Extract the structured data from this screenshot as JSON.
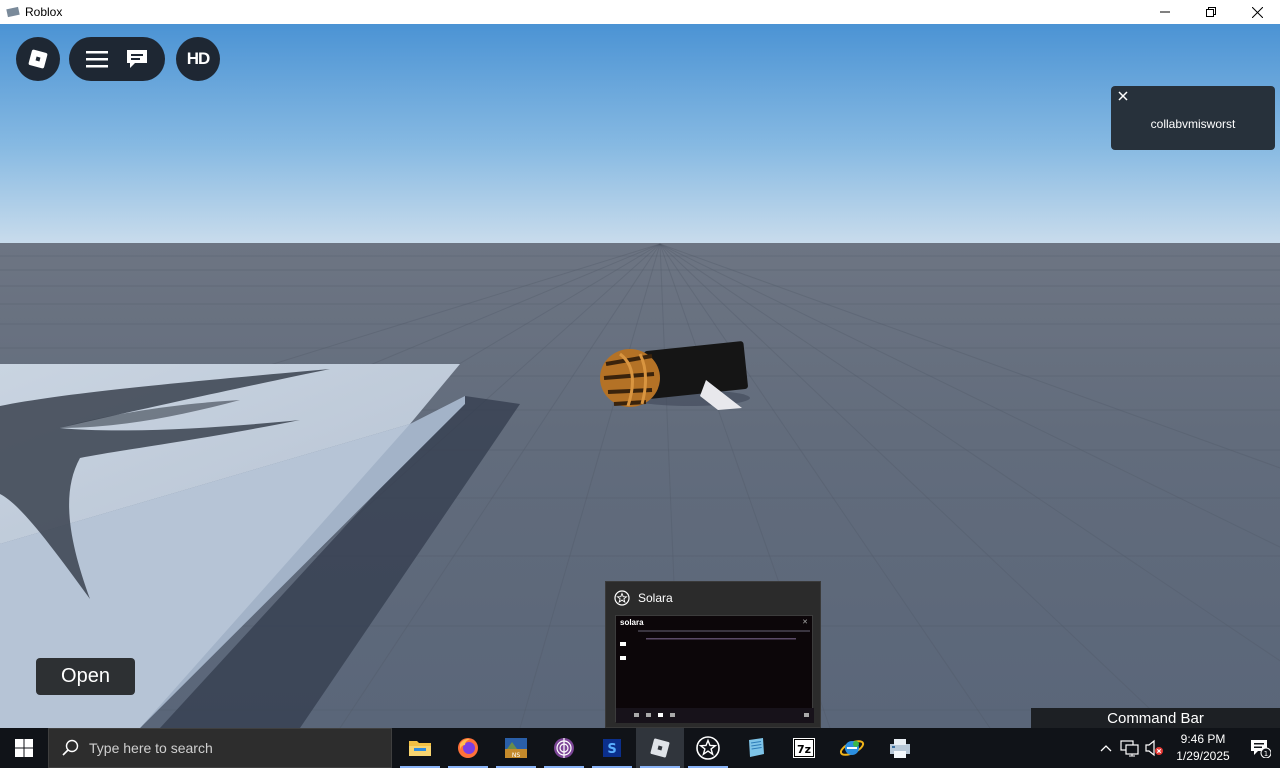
{
  "window": {
    "title": "Roblox",
    "icon": "roblox-app-icon"
  },
  "top_buttons": {
    "logo_icon": "roblox-logo-icon",
    "menu_icon": "hamburger-menu-icon",
    "chat_icon": "chat-icon",
    "hd_label": "HD"
  },
  "notification": {
    "text": "collabvmisworst",
    "close_icon": "close-icon"
  },
  "open_button": {
    "label": "Open"
  },
  "command_bar": {
    "label": "Command Bar"
  },
  "preview": {
    "title": "Solara",
    "thumb_title": "solara",
    "icon": "solara-star-icon"
  },
  "taskbar": {
    "search_placeholder": "Type here to search",
    "apps": [
      {
        "name": "file-explorer-icon",
        "active": false,
        "open": true
      },
      {
        "name": "firefox-icon",
        "active": false,
        "open": true
      },
      {
        "name": "game-icon",
        "active": false,
        "open": true
      },
      {
        "name": "tor-browser-icon",
        "active": false,
        "open": true
      },
      {
        "name": "blue-app-icon",
        "active": false,
        "open": true
      },
      {
        "name": "roblox-taskbar-icon",
        "active": true,
        "open": true
      },
      {
        "name": "solara-taskbar-icon",
        "active": false,
        "open": true
      },
      {
        "name": "notepad-icon",
        "active": false,
        "open": false
      },
      {
        "name": "7zip-icon",
        "active": false,
        "open": false
      },
      {
        "name": "internet-explorer-icon",
        "active": false,
        "open": false
      },
      {
        "name": "printer-app-icon",
        "active": false,
        "open": false
      }
    ],
    "clock": {
      "time": "9:46 PM",
      "date": "1/29/2025"
    },
    "notification_count": "1"
  },
  "colors": {
    "sky_top": "#4b93d4",
    "sky_bottom": "#c9dcec",
    "ground": "#5e6878",
    "taskbar": "#101318",
    "panel_dark": "#1e2733"
  }
}
